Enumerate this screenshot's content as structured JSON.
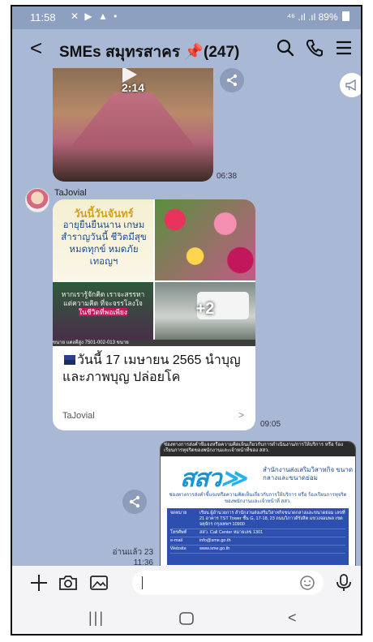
{
  "status": {
    "time": "11:58",
    "icons": "✕ ▶ ▲ •",
    "signal": "⁴⁶ .ıl .ıl",
    "battery": "89%"
  },
  "header": {
    "title": "SMEs สมุทรสาคร",
    "pin": "📌",
    "count": "(247)"
  },
  "messages": {
    "video_duration": "2:14",
    "video_time": "06:38",
    "sender": "TaJovial",
    "poem_line1": "วันนี้วันจันทร์",
    "poem_lines": "อายุยืนยืนนาน เกษมสำราญวันนี้ ชีวิตมีสุข หมดทุกข์ หมดภัยเทอญฯ",
    "grid_text": "หากเรารู้จักคิด เราจะสรรหาแต่ความคิด ที่จะจรรโลงใจ",
    "grid_highlight": "ในชีวิตที่พอเพียง",
    "more_count": "+2",
    "strip_text": "ขนาย แตงดีสูง 7501-002-013 ขนาย",
    "caption": "วันนี้ 17 เมษายน 2565 นำบุญและภาพบุญ ปล่อยโค",
    "card_footer": "TaJovial",
    "card_time": "09:05",
    "read_label": "อ่านแล้ว 23",
    "read_time": "11:36"
  },
  "doc": {
    "top": "ช่องทางการส่งคำชี้แจงหรือความคิดเห็นเกี่ยวกับการดำเนินงาน/การให้บริการ หรือ ร้องเรียนการทุจริตของพนักงานและเจ้าหน้าที่ของ สสว.",
    "logo": "สสว",
    "logo_text": "สำนักงานส่งเสริมวิสาหกิจ ขนาดกลางและขนาดย่อม",
    "sub": "ช่องทางการส่งคำชี้แจงหรือความคิดเห็นเกี่ยวกับการให้บริการ หรือ ร้องเรียนการทุจริตของพนักงานและเจ้าหน้าที่ สสว.",
    "rows": [
      {
        "k": "จดหมาย",
        "v": "เรียน ผู้อำนวยการ สำนักงานส่งเสริมวิสาหกิจขนาดกลางและขนาดย่อม เลขที่ 21 อาคาร TST Tower ชั้น G, 17-18, 23 ถนนวิภาวดีรังสิต แขวงจอมพล เขตจตุจักร กรุงเทพฯ 10900"
      },
      {
        "k": "โทรศัพท์",
        "v": "สสว. Call Center หมายเลข 1301"
      },
      {
        "k": "e-mail",
        "v": "info@sme.go.th"
      },
      {
        "k": "Website",
        "v": "www.sme.go.th"
      }
    ]
  },
  "input": {
    "placeholder": ""
  }
}
